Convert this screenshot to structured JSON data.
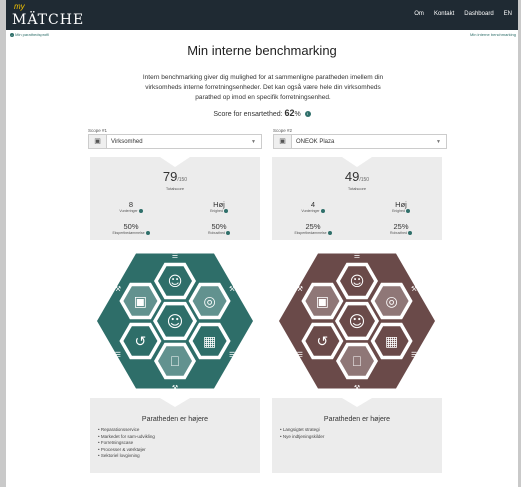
{
  "app": {
    "logo_my": "my",
    "logo_name": "MÄTCHE"
  },
  "nav": {
    "items": [
      "Om",
      "Kontakt",
      "Dashboard",
      "EN"
    ]
  },
  "subbar": {
    "left": "Min parathedsprofil",
    "right": "Min interne benchmarking"
  },
  "page": {
    "title": "Min interne benchmarking",
    "intro": "Intern benchmarking giver dig mulighed for at sammenligne paratheden imellem din virksomheds interne forretningsenheder. Det kan også være hele din virksomheds parathed op imod en specifik forretningsenhed.",
    "score_label": "Score for ensartethed:",
    "score_value": "62",
    "score_unit": "%"
  },
  "colors": {
    "accent": "#2f6f6a",
    "scope1_hex": "#2e6e69",
    "scope2_hex": "#6a4a49",
    "topbar": "#1f2a33"
  },
  "scope1": {
    "label": "Scope #1",
    "icon": "factory-icon",
    "selected": "Virksomhed",
    "total": "79",
    "total_max": "/150",
    "total_label": "Totalscore",
    "m1_value": "8",
    "m1_label": "Vurderinger",
    "m2_value": "Høj",
    "m2_label": "Enighed",
    "m3_value": "50%",
    "m3_label": "Ekspertbedømmelse",
    "m4_value": "50%",
    "m4_label": "Robusthed",
    "panel_title": "Paratheden er højere",
    "panel_items": [
      "Reparationsservice",
      "Markedet for sam-udvikling",
      "Forretningscase",
      "Processer & værktøjer",
      "Sektoriel lovgivning"
    ]
  },
  "scope2": {
    "label": "Scope #2",
    "icon": "factory-icon",
    "selected": "ONEOK Plaza",
    "total": "49",
    "total_max": "/150",
    "total_label": "Totalscore",
    "m1_value": "4",
    "m1_label": "Vurderinger",
    "m2_value": "Høj",
    "m2_label": "Enighed",
    "m3_value": "25%",
    "m3_label": "Ekspertbedømmelse",
    "m4_value": "25%",
    "m4_label": "Robusthed",
    "panel_title": "Paratheden er højere",
    "panel_items": [
      "Langsigtet strategi",
      "Nye indtjeningskilder"
    ]
  }
}
